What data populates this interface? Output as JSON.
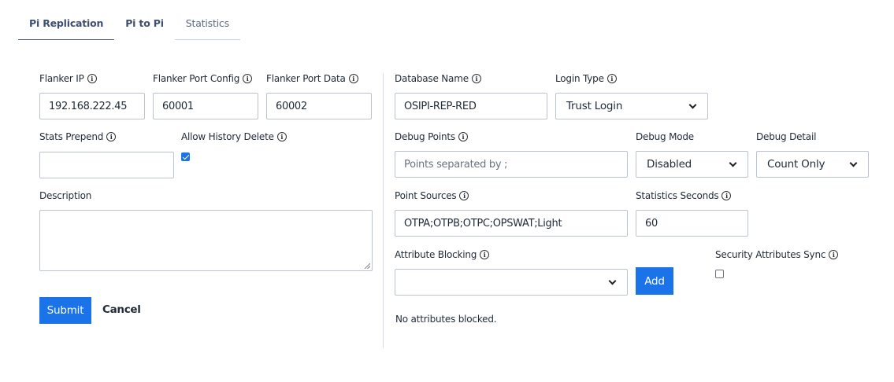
{
  "tabs": [
    {
      "label": "Pi Replication",
      "active": true
    },
    {
      "label": "Pi to Pi",
      "active": false
    },
    {
      "label": "Statistics",
      "active": false
    }
  ],
  "left": {
    "flanker_ip": {
      "label": "Flanker IP",
      "value": "192.168.222.45"
    },
    "port_config": {
      "label": "Flanker Port Config",
      "value": "60001"
    },
    "port_data": {
      "label": "Flanker Port Data",
      "value": "60002"
    },
    "stats_prepend": {
      "label": "Stats Prepend",
      "value": ""
    },
    "allow_history_delete": {
      "label": "Allow History Delete",
      "checked": true
    },
    "description": {
      "label": "Description",
      "value": ""
    },
    "submit_label": "Submit",
    "cancel_label": "Cancel"
  },
  "right": {
    "database_name": {
      "label": "Database Name",
      "value": "OSIPI-REP-RED"
    },
    "login_type": {
      "label": "Login Type",
      "value": "Trust Login"
    },
    "debug_points": {
      "label": "Debug Points",
      "placeholder": "Points separated by ;"
    },
    "debug_mode": {
      "label": "Debug Mode",
      "value": "Disabled"
    },
    "debug_detail": {
      "label": "Debug Detail",
      "value": "Count Only"
    },
    "point_sources": {
      "label": "Point Sources",
      "value": "OTPA;OTPB;OTPC;OPSWAT;Light"
    },
    "statistics_seconds": {
      "label": "Statistics Seconds",
      "value": "60"
    },
    "attribute_blocking": {
      "label": "Attribute Blocking",
      "value": ""
    },
    "add_label": "Add",
    "security_sync": {
      "label": "Security Attributes Sync",
      "checked": false
    },
    "blocked_note": "No attributes blocked."
  },
  "colors": {
    "accent": "#1a73e8",
    "tab_text": "#3d4f73",
    "border": "#bcc4cf"
  },
  "icons": {
    "info": "info-icon",
    "dropdown": "chevron-down-icon",
    "check": "check-icon"
  }
}
